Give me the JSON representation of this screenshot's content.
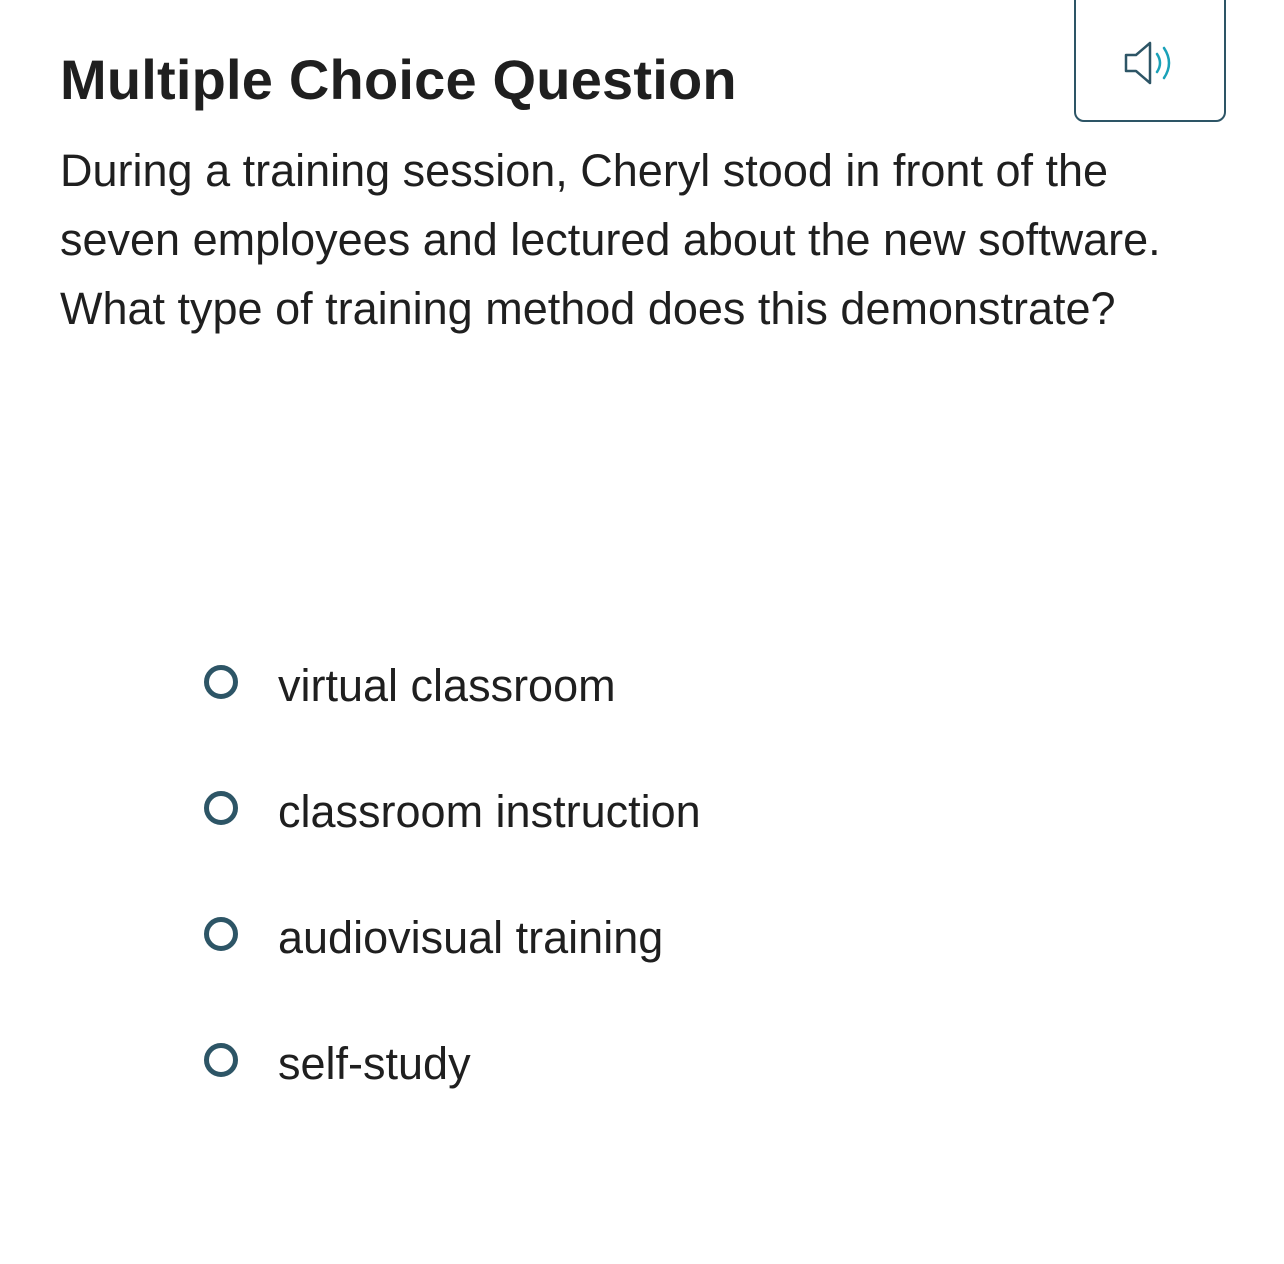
{
  "header": {
    "title": "Multiple Choice Question",
    "audio_icon": "speaker-icon"
  },
  "question": {
    "text": "During a training session, Cheryl stood in front of the seven employees and lectured about the new software. What type of training method does this demonstrate?"
  },
  "options": [
    {
      "label": "virtual classroom",
      "selected": false
    },
    {
      "label": "classroom instruction",
      "selected": false
    },
    {
      "label": "audiovisual training",
      "selected": false
    },
    {
      "label": "self-study",
      "selected": false
    }
  ],
  "colors": {
    "accent": "#2d5566",
    "speaker_waves": "#1aa1b8",
    "text": "#1f1f1f"
  }
}
